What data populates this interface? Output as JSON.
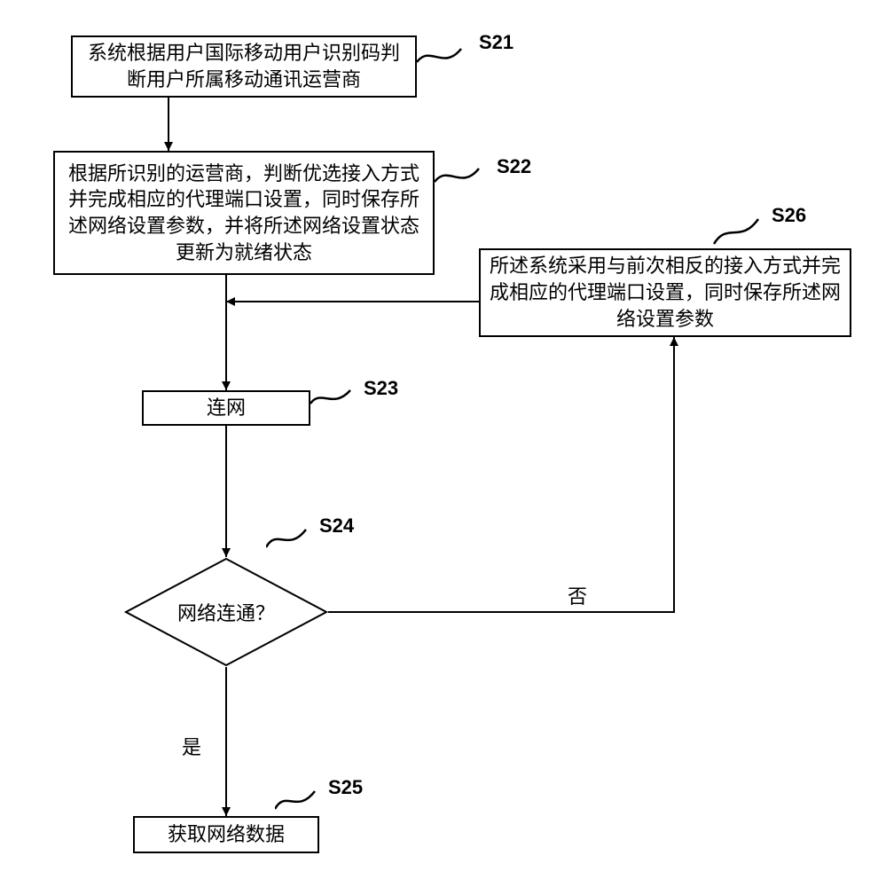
{
  "chart_data": {
    "type": "flowchart",
    "nodes": [
      {
        "id": "S21",
        "kind": "process",
        "text": "系统根据用户国际移动用户识别码判断用户所属移动通讯运营商",
        "label": "S21"
      },
      {
        "id": "S22",
        "kind": "process",
        "text": "根据所识别的运营商，判断优选接入方式并完成相应的代理端口设置，同时保存所述网络设置参数，并将所述网络设置状态更新为就绪状态",
        "label": "S22"
      },
      {
        "id": "S23",
        "kind": "process",
        "text": "连网",
        "label": "S23"
      },
      {
        "id": "S24",
        "kind": "decision",
        "text": "网络连通？",
        "label": "S24"
      },
      {
        "id": "S25",
        "kind": "process",
        "text": "获取网络数据",
        "label": "S25"
      },
      {
        "id": "S26",
        "kind": "process",
        "text": "所述系统采用与前次相反的接入方式并完成相应的代理端口设置，同时保存所述网络设置参数",
        "label": "S26"
      }
    ],
    "edges": [
      {
        "from": "S21",
        "to": "S22",
        "label": ""
      },
      {
        "from": "S22",
        "to": "S23",
        "label": ""
      },
      {
        "from": "S23",
        "to": "S24",
        "label": ""
      },
      {
        "from": "S24",
        "to": "S25",
        "label": "是"
      },
      {
        "from": "S24",
        "to": "S26",
        "label": "否"
      },
      {
        "from": "S26",
        "to": "S23_inflow",
        "label": ""
      }
    ],
    "decision_labels": {
      "yes": "是",
      "no": "否"
    }
  },
  "nodes": {
    "s21": {
      "text": "系统根据用户国际移动用户识别码判断用户所属移动通讯运营商",
      "label": "S21"
    },
    "s22": {
      "text": "根据所识别的运营商，判断优选接入方式并完成相应的代理端口设置，同时保存所述网络设置参数，并将所述网络设置状态更新为就绪状态",
      "label": "S22"
    },
    "s23": {
      "text": "连网",
      "label": "S23"
    },
    "s24": {
      "text": "网络连通？",
      "label": "S24"
    },
    "s25": {
      "text": "获取网络数据",
      "label": "S25"
    },
    "s26": {
      "text": "所述系统采用与前次相反的接入方式并完成相应的代理端口设置，同时保存所述网络设置参数",
      "label": "S26"
    }
  },
  "branches": {
    "yes": "是",
    "no": "否"
  }
}
